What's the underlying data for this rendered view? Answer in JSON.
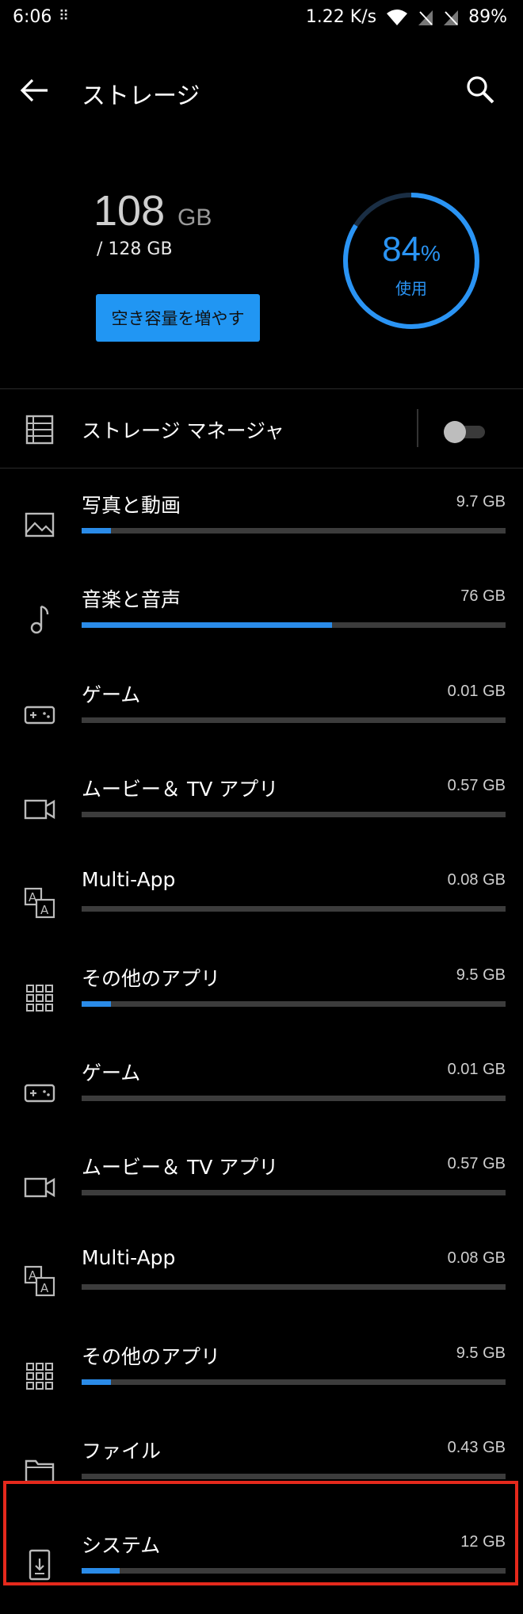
{
  "status_bar": {
    "time": "6:06",
    "speed": "1.22 K/s",
    "battery": "89%"
  },
  "app_bar": {
    "title": "ストレージ"
  },
  "summary": {
    "used_value": "108",
    "used_unit": "GB",
    "total": "/ 128 GB",
    "free_up_button": "空き容量を増やす",
    "percent_value": "84",
    "percent_sign": "%",
    "percent_label": "使用",
    "percent_fraction": 0.84
  },
  "storage_manager": {
    "label": "ストレージ マネージャ",
    "enabled": false
  },
  "accent_color": "#2196f3",
  "items": [
    {
      "label": "写真と動画",
      "size": "9.7 GB",
      "icon": "image-icon",
      "fill_fraction": 0.07
    },
    {
      "label": "音楽と音声",
      "size": "76 GB",
      "icon": "music-note-icon",
      "fill_fraction": 0.59
    },
    {
      "label": "ゲーム",
      "size": "0.01 GB",
      "icon": "gamepad-icon",
      "fill_fraction": 0
    },
    {
      "label": "ムービー＆ TV アプリ",
      "size": "0.57 GB",
      "icon": "video-camera-icon",
      "fill_fraction": 0
    },
    {
      "label": "Multi-App",
      "size": "0.08 GB",
      "icon": "multi-app-icon",
      "fill_fraction": 0
    },
    {
      "label": "その他のアプリ",
      "size": "9.5 GB",
      "icon": "apps-grid-icon",
      "fill_fraction": 0.07
    },
    {
      "label": "ゲーム",
      "size": "0.01 GB",
      "icon": "gamepad-icon",
      "fill_fraction": 0
    },
    {
      "label": "ムービー＆ TV アプリ",
      "size": "0.57 GB",
      "icon": "video-camera-icon",
      "fill_fraction": 0
    },
    {
      "label": "Multi-App",
      "size": "0.08 GB",
      "icon": "multi-app-icon",
      "fill_fraction": 0
    },
    {
      "label": "その他のアプリ",
      "size": "9.5 GB",
      "icon": "apps-grid-icon",
      "fill_fraction": 0.07
    },
    {
      "label": "ファイル",
      "size": "0.43 GB",
      "icon": "folder-icon",
      "fill_fraction": 0
    },
    {
      "label": "システム",
      "size": "12 GB",
      "icon": "system-phone-icon",
      "fill_fraction": 0.09
    }
  ]
}
